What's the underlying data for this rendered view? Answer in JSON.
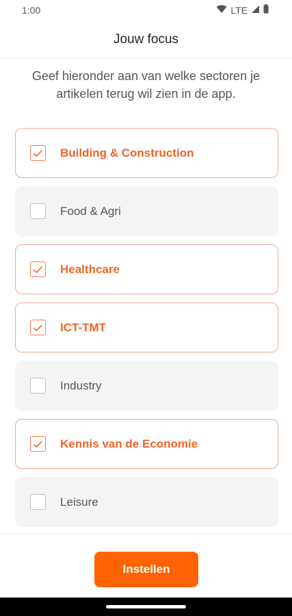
{
  "status": {
    "time": "1:00",
    "network": "LTE"
  },
  "header": {
    "title": "Jouw focus"
  },
  "intro": "Geef hieronder aan van welke sectoren je artikelen terug wil zien in de app.",
  "sectors": [
    {
      "label": "Building & Construction",
      "checked": true
    },
    {
      "label": "Food & Agri",
      "checked": false
    },
    {
      "label": "Healthcare",
      "checked": true
    },
    {
      "label": "ICT-TMT",
      "checked": true
    },
    {
      "label": "Industry",
      "checked": false
    },
    {
      "label": "Kennis van de Economie",
      "checked": true
    },
    {
      "label": "Leisure",
      "checked": false
    }
  ],
  "footer": {
    "button_label": "Instellen"
  },
  "colors": {
    "accent": "#ff6200",
    "checked_text": "#f26323",
    "checked_border": "#f6a98e",
    "unchecked_bg": "#f4f4f4"
  }
}
